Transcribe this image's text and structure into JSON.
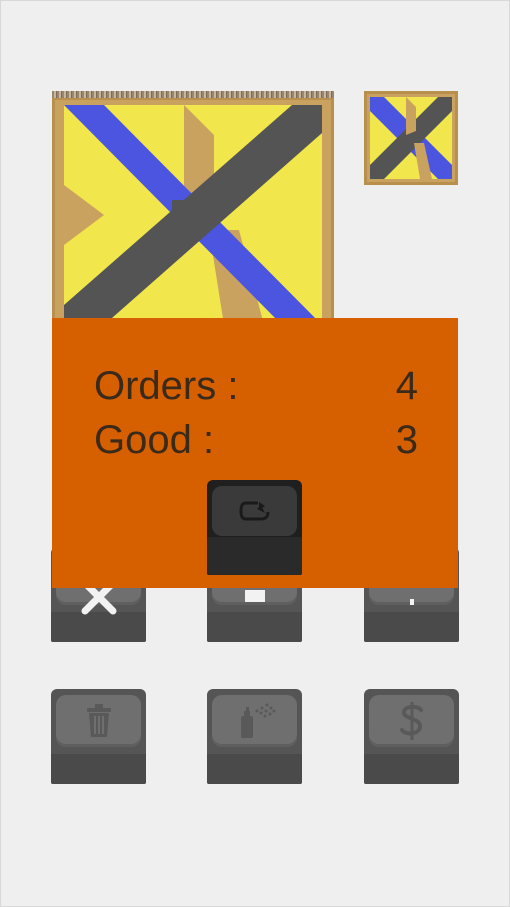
{
  "game": {
    "target_pattern_name": "diagonal-cross",
    "colors": {
      "yellow": "#f1e64c",
      "blue": "#4b55e0",
      "gray": "#545454",
      "tan": "#c9a25f",
      "orange": "#d65f00"
    }
  },
  "results": {
    "orders_label": "Orders :",
    "orders_value": "4",
    "good_label": "Good :",
    "good_value": "3"
  },
  "buttons": [
    {
      "name": "cancel",
      "icon": "close-icon"
    },
    {
      "name": "middle",
      "icon": "minus-icon"
    },
    {
      "name": "up",
      "icon": "arrow-up-icon"
    },
    {
      "name": "trash",
      "icon": "trash-icon"
    },
    {
      "name": "spray",
      "icon": "spray-paint-icon"
    },
    {
      "name": "sell",
      "icon": "dollar-icon"
    }
  ],
  "reset_icon": "restart-icon"
}
